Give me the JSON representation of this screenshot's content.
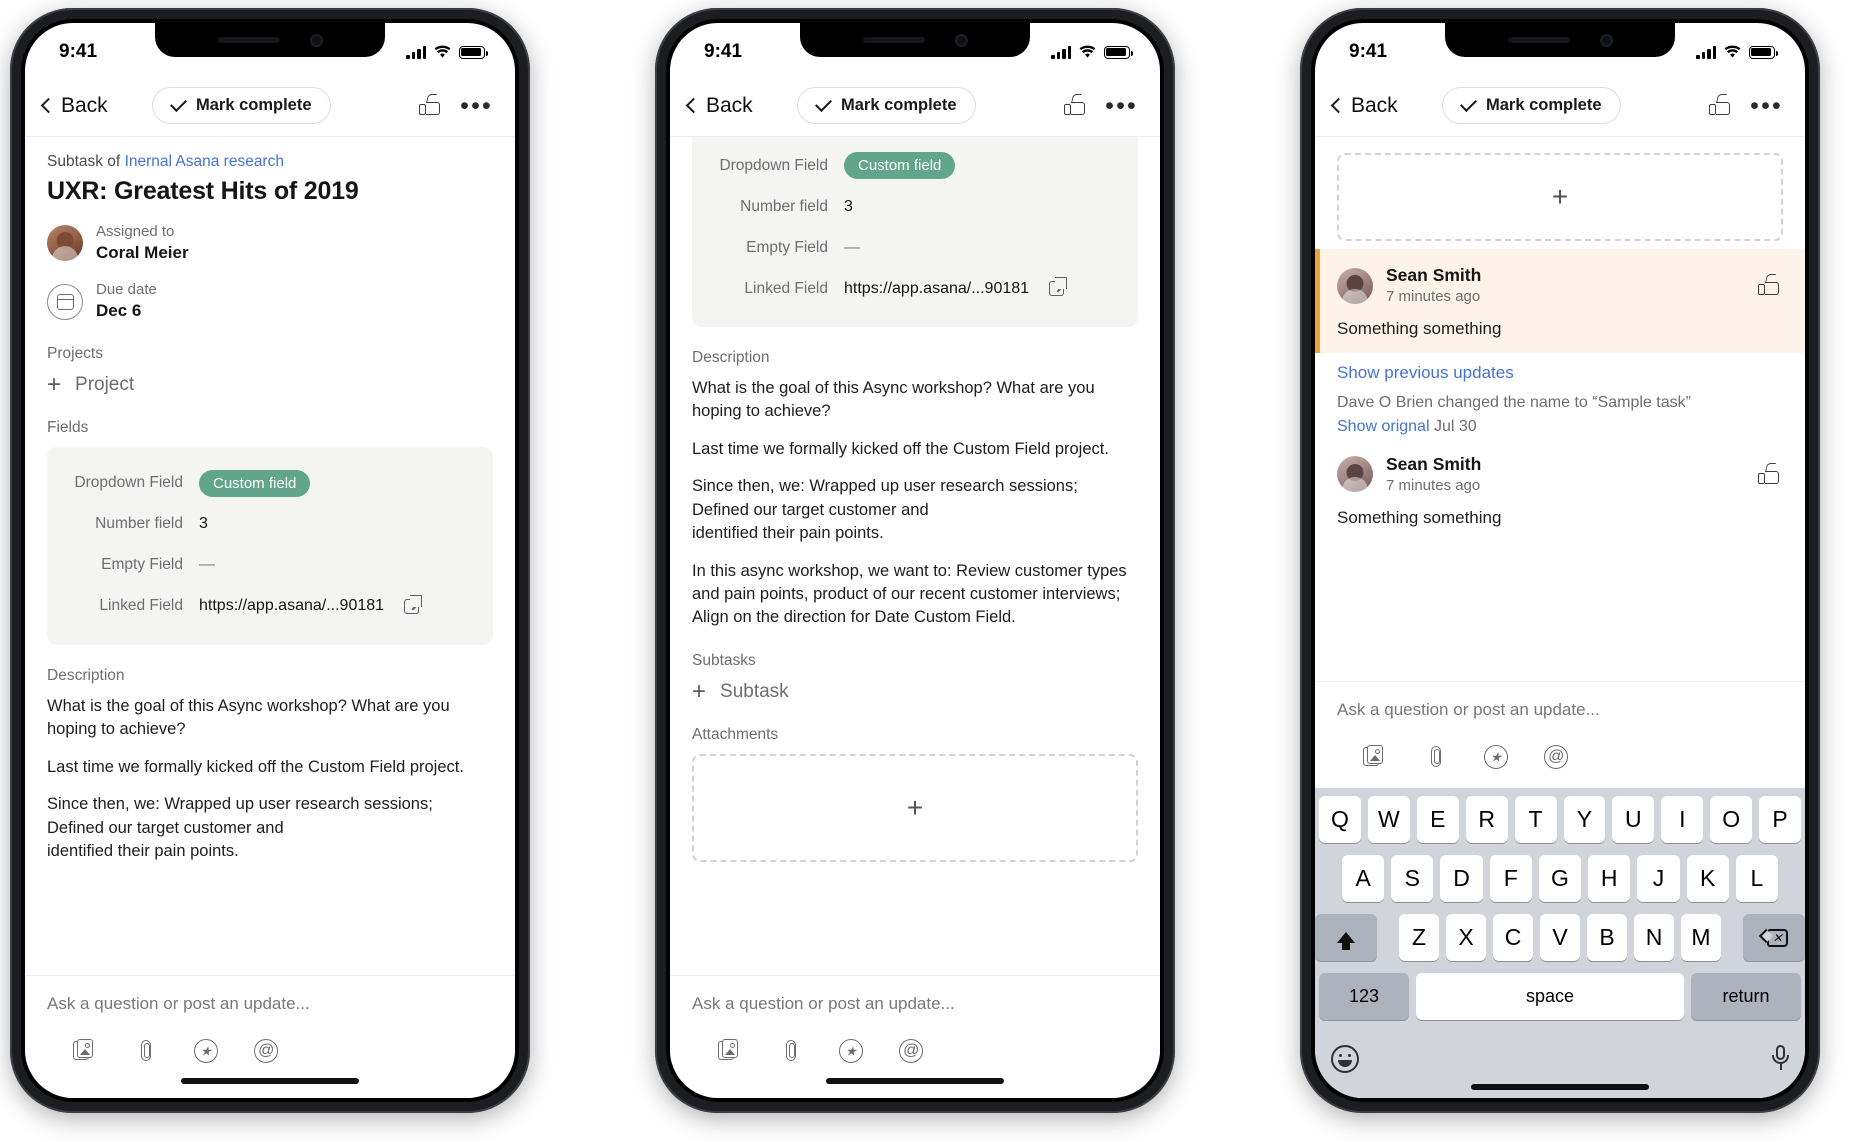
{
  "status_bar": {
    "time": "9:41"
  },
  "nav": {
    "back_label": "Back",
    "mark_complete_label": "Mark complete"
  },
  "task": {
    "subtask_of_prefix": "Subtask of",
    "parent_task": "Inernal Asana research",
    "title": "UXR: Greatest Hits of 2019",
    "assignee_label": "Assigned to",
    "assignee_name": "Coral Meier",
    "due_label": "Due date",
    "due_value": "Dec 6",
    "projects_label": "Projects",
    "add_project_label": "Project",
    "fields_label": "Fields",
    "description_label": "Description",
    "subtasks_label": "Subtasks",
    "add_subtask_label": "Subtask",
    "attachments_label": "Attachments",
    "add_icon": "plus-icon"
  },
  "fields": [
    {
      "label": "Dropdown Field",
      "value": "Custom field",
      "type": "pill"
    },
    {
      "label": "Number field",
      "value": "3",
      "type": "text"
    },
    {
      "label": "Empty Field",
      "value": "—",
      "type": "empty"
    },
    {
      "label": "Linked Field",
      "value": "https://app.asana/...90181",
      "type": "link"
    }
  ],
  "description_paragraphs": [
    "What is the goal of this Async workshop? What are you hoping to achieve?",
    "Last time we formally kicked off the Custom Field project.",
    "Since then, we: Wrapped up user research sessions; Defined our target customer and\nidentified their pain points.",
    "In this async workshop, we want to: Review customer types and pain points, product of our recent customer interviews; Align on the direction for Date Custom Field."
  ],
  "composer": {
    "placeholder": "Ask a question or post an update...",
    "icons": [
      "photo-icon",
      "paperclip-icon",
      "star-icon",
      "mention-icon"
    ]
  },
  "comments": {
    "show_previous_label": "Show previous updates",
    "story_text": "Dave O Brien changed the name to “Sample task”",
    "story_link": "Show orignal",
    "story_date": "Jul 30",
    "items": [
      {
        "name": "Sean Smith",
        "time": "7 minutes ago",
        "body": "Something something",
        "highlight": true
      },
      {
        "name": "Sean Smith",
        "time": "7 minutes ago",
        "body": "Something something",
        "highlight": false
      }
    ]
  },
  "keyboard": {
    "row1": [
      "Q",
      "W",
      "E",
      "R",
      "T",
      "Y",
      "U",
      "I",
      "O",
      "P"
    ],
    "row2": [
      "A",
      "S",
      "D",
      "F",
      "G",
      "H",
      "J",
      "K",
      "L"
    ],
    "row3": [
      "Z",
      "X",
      "C",
      "V",
      "B",
      "N",
      "M"
    ],
    "shift_icon": "shift-icon",
    "delete_icon": "backspace-icon",
    "numbers_label": "123",
    "space_label": "space",
    "return_label": "return",
    "emoji_icon": "emoji-icon",
    "mic_icon": "microphone-icon"
  },
  "colors": {
    "accent_green": "#62a58d",
    "link_blue": "#4573d2",
    "highlight_bg": "#fdf3e8",
    "highlight_bar": "#e8a33d"
  }
}
